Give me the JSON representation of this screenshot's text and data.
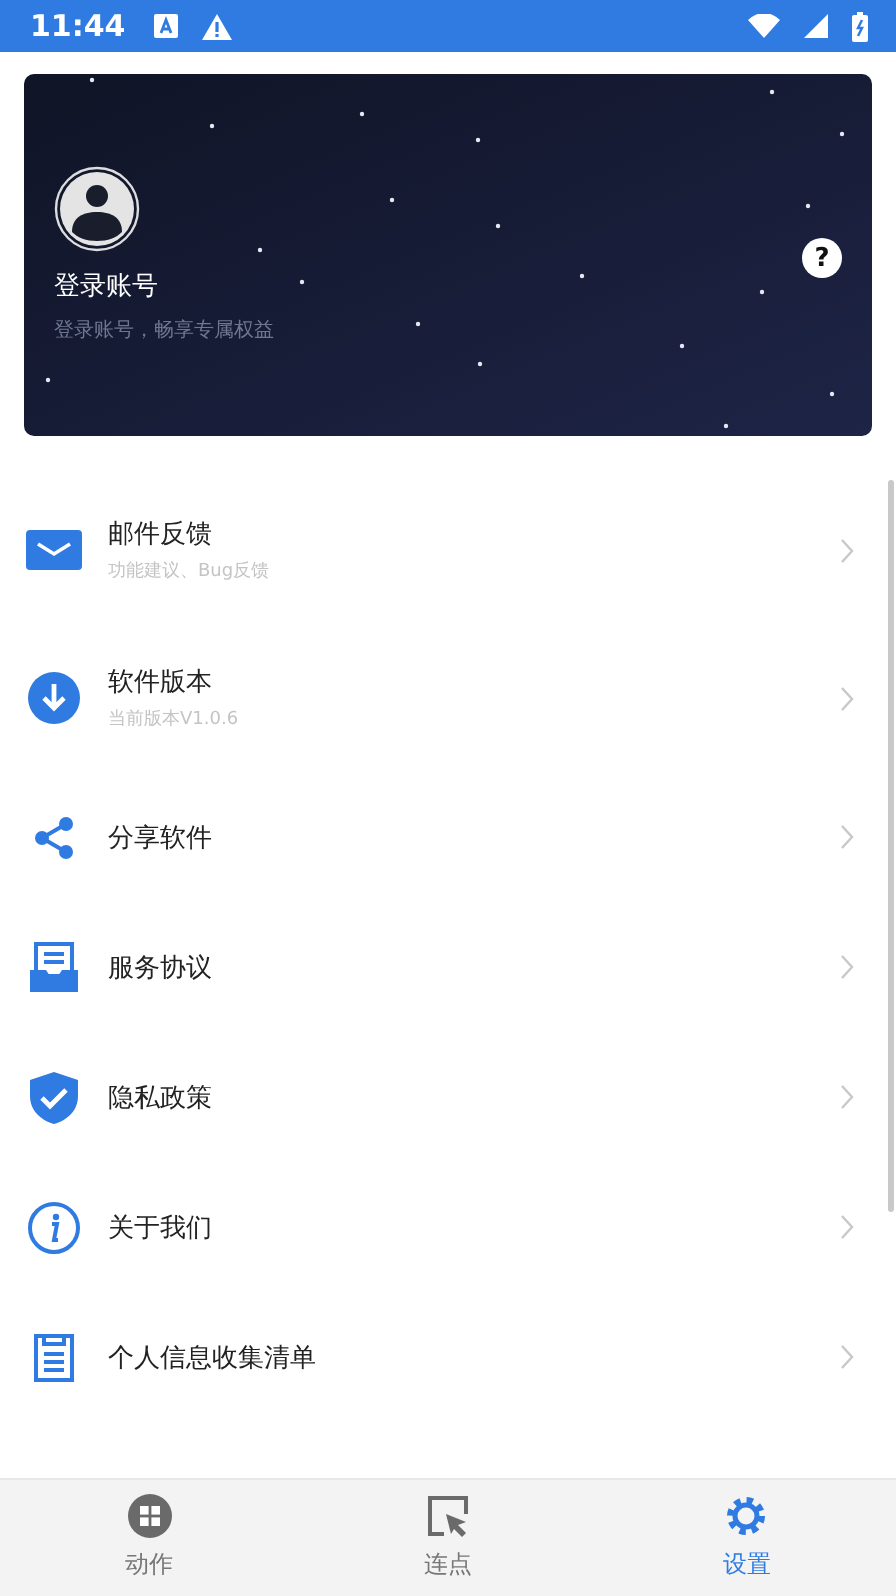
{
  "status_bar": {
    "time": "11:44"
  },
  "account_card": {
    "title": "登录账号",
    "subtitle": "登录账号，畅享专属权益",
    "help": "?"
  },
  "menu": [
    {
      "title": "邮件反馈",
      "subtitle": "功能建议、Bug反馈"
    },
    {
      "title": "软件版本",
      "subtitle": "当前版本V1.0.6"
    },
    {
      "title": "分享软件"
    },
    {
      "title": "服务协议"
    },
    {
      "title": "隐私政策"
    },
    {
      "title": "关于我们"
    },
    {
      "title": "个人信息收集清单"
    }
  ],
  "bottom_nav": [
    {
      "label": "动作",
      "selected": false
    },
    {
      "label": "连点",
      "selected": false
    },
    {
      "label": "设置",
      "selected": true
    }
  ]
}
